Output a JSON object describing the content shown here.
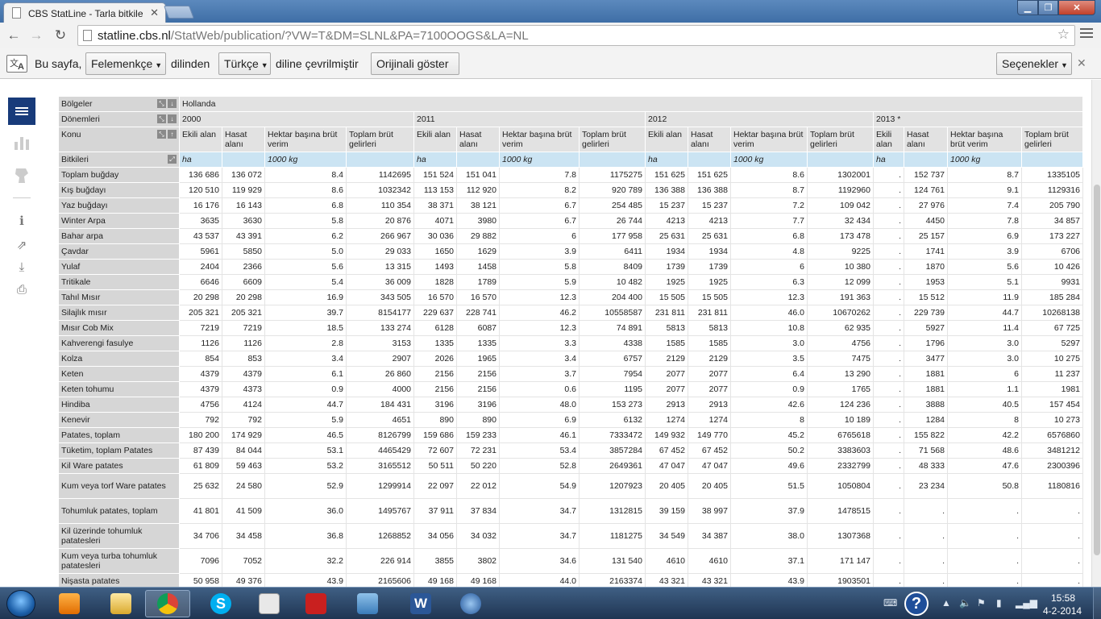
{
  "browser": {
    "tab_title": "CBS StatLine - Tarla bitkile",
    "url_domain": "statline.cbs.nl",
    "url_path": "/StatWeb/publication/?VW=T&DM=SLNL&PA=7100OOGS&LA=NL"
  },
  "translate_bar": {
    "prefix": "Bu sayfa,",
    "source_language": "Felemenkçe",
    "middle": "dilinden",
    "target_language": "Türkçe",
    "suffix": "diline çevrilmiştir",
    "show_original": "Orijinali göster",
    "options": "Seçenekler"
  },
  "table": {
    "header": {
      "regions_label": "Bölgeler",
      "region_value": "Hollanda",
      "periods_label": "Dönemleri",
      "subject_label": "Konu",
      "crops_label": "Bitkileri",
      "years": [
        "2000",
        "2011",
        "2012",
        "2013 *"
      ],
      "columns": [
        "Ekili alan",
        "Hasat alanı",
        "Hektar başına brüt verim",
        "Toplam brüt gelirleri"
      ],
      "units": [
        "ha",
        "1000 kg"
      ]
    },
    "rows": [
      {
        "label": "Toplam buğday",
        "v": [
          "136 686",
          "136 072",
          "8.4",
          "1142695",
          "151 524",
          "151 041",
          "7.8",
          "1175275",
          "151 625",
          "151 625",
          "8.6",
          "1302001",
          ".",
          "152 737",
          "8.7",
          "1335105"
        ]
      },
      {
        "label": "Kış buğdayı",
        "v": [
          "120 510",
          "119 929",
          "8.6",
          "1032342",
          "113 153",
          "112 920",
          "8.2",
          "920 789",
          "136 388",
          "136 388",
          "8.7",
          "1192960",
          ".",
          "124 761",
          "9.1",
          "1129316"
        ]
      },
      {
        "label": "Yaz buğdayı",
        "v": [
          "16 176",
          "16 143",
          "6.8",
          "110 354",
          "38 371",
          "38 121",
          "6.7",
          "254 485",
          "15 237",
          "15 237",
          "7.2",
          "109 042",
          ".",
          "27 976",
          "7.4",
          "205 790"
        ]
      },
      {
        "label": "Winter Arpa",
        "v": [
          "3635",
          "3630",
          "5.8",
          "20 876",
          "4071",
          "3980",
          "6.7",
          "26 744",
          "4213",
          "4213",
          "7.7",
          "32 434",
          ".",
          "4450",
          "7.8",
          "34 857"
        ]
      },
      {
        "label": "Bahar arpa",
        "v": [
          "43 537",
          "43 391",
          "6.2",
          "266 967",
          "30 036",
          "29 882",
          "6",
          "177 958",
          "25 631",
          "25 631",
          "6.8",
          "173 478",
          ".",
          "25 157",
          "6.9",
          "173 227"
        ]
      },
      {
        "label": "Çavdar",
        "v": [
          "5961",
          "5850",
          "5.0",
          "29 033",
          "1650",
          "1629",
          "3.9",
          "6411",
          "1934",
          "1934",
          "4.8",
          "9225",
          ".",
          "1741",
          "3.9",
          "6706"
        ]
      },
      {
        "label": "Yulaf",
        "v": [
          "2404",
          "2366",
          "5.6",
          "13 315",
          "1493",
          "1458",
          "5.8",
          "8409",
          "1739",
          "1739",
          "6",
          "10 380",
          ".",
          "1870",
          "5.6",
          "10 426"
        ]
      },
      {
        "label": "Tritikale",
        "v": [
          "6646",
          "6609",
          "5.4",
          "36 009",
          "1828",
          "1789",
          "5.9",
          "10 482",
          "1925",
          "1925",
          "6.3",
          "12 099",
          ".",
          "1953",
          "5.1",
          "9931"
        ]
      },
      {
        "label": "Tahıl Mısır",
        "v": [
          "20 298",
          "20 298",
          "16.9",
          "343 505",
          "16 570",
          "16 570",
          "12.3",
          "204 400",
          "15 505",
          "15 505",
          "12.3",
          "191 363",
          ".",
          "15 512",
          "11.9",
          "185 284"
        ]
      },
      {
        "label": "Silajlık mısır",
        "v": [
          "205 321",
          "205 321",
          "39.7",
          "8154177",
          "229 637",
          "228 741",
          "46.2",
          "10558587",
          "231 811",
          "231 811",
          "46.0",
          "10670262",
          ".",
          "229 739",
          "44.7",
          "10268138"
        ]
      },
      {
        "label": "Mısır Cob Mix",
        "v": [
          "7219",
          "7219",
          "18.5",
          "133 274",
          "6128",
          "6087",
          "12.3",
          "74 891",
          "5813",
          "5813",
          "10.8",
          "62 935",
          ".",
          "5927",
          "11.4",
          "67 725"
        ]
      },
      {
        "label": "Kahverengi fasulye",
        "v": [
          "1126",
          "1126",
          "2.8",
          "3153",
          "1335",
          "1335",
          "3.3",
          "4338",
          "1585",
          "1585",
          "3.0",
          "4756",
          ".",
          "1796",
          "3.0",
          "5297"
        ]
      },
      {
        "label": "Kolza",
        "v": [
          "854",
          "853",
          "3.4",
          "2907",
          "2026",
          "1965",
          "3.4",
          "6757",
          "2129",
          "2129",
          "3.5",
          "7475",
          ".",
          "3477",
          "3.0",
          "10 275"
        ]
      },
      {
        "label": "Keten",
        "v": [
          "4379",
          "4379",
          "6.1",
          "26 860",
          "2156",
          "2156",
          "3.7",
          "7954",
          "2077",
          "2077",
          "6.4",
          "13 290",
          ".",
          "1881",
          "6",
          "11 237"
        ]
      },
      {
        "label": "Keten tohumu",
        "v": [
          "4379",
          "4373",
          "0.9",
          "4000",
          "2156",
          "2156",
          "0.6",
          "1195",
          "2077",
          "2077",
          "0.9",
          "1765",
          ".",
          "1881",
          "1.1",
          "1981"
        ]
      },
      {
        "label": "Hindiba",
        "v": [
          "4756",
          "4124",
          "44.7",
          "184 431",
          "3196",
          "3196",
          "48.0",
          "153 273",
          "2913",
          "2913",
          "42.6",
          "124 236",
          ".",
          "3888",
          "40.5",
          "157 454"
        ]
      },
      {
        "label": "Kenevir",
        "v": [
          "792",
          "792",
          "5.9",
          "4651",
          "890",
          "890",
          "6.9",
          "6132",
          "1274",
          "1274",
          "8",
          "10 189",
          ".",
          "1284",
          "8",
          "10 273"
        ]
      },
      {
        "label": "Patates, toplam",
        "v": [
          "180 200",
          "174 929",
          "46.5",
          "8126799",
          "159 686",
          "159 233",
          "46.1",
          "7333472",
          "149 932",
          "149 770",
          "45.2",
          "6765618",
          ".",
          "155 822",
          "42.2",
          "6576860"
        ]
      },
      {
        "label": "Tüketim, toplam Patates",
        "v": [
          "87 439",
          "84 044",
          "53.1",
          "4465429",
          "72 607",
          "72 231",
          "53.4",
          "3857284",
          "67 452",
          "67 452",
          "50.2",
          "3383603",
          ".",
          "71 568",
          "48.6",
          "3481212"
        ]
      },
      {
        "label": "Kil Ware patates",
        "v": [
          "61 809",
          "59 463",
          "53.2",
          "3165512",
          "50 511",
          "50 220",
          "52.8",
          "2649361",
          "47 047",
          "47 047",
          "49.6",
          "2332799",
          ".",
          "48 333",
          "47.6",
          "2300396"
        ]
      },
      {
        "label": "Kum veya torf Ware patates",
        "tall": true,
        "v": [
          "25 632",
          "24 580",
          "52.9",
          "1299914",
          "22 097",
          "22 012",
          "54.9",
          "1207923",
          "20 405",
          "20 405",
          "51.5",
          "1050804",
          ".",
          "23 234",
          "50.8",
          "1180816"
        ]
      },
      {
        "label": "Tohumluk patates, toplam",
        "tall": true,
        "v": [
          "41 801",
          "41 509",
          "36.0",
          "1495767",
          "37 911",
          "37 834",
          "34.7",
          "1312815",
          "39 159",
          "38 997",
          "37.9",
          "1478515",
          ".",
          ".",
          ".",
          "."
        ]
      },
      {
        "label": "Kil üzerinde tohumluk patatesleri",
        "tall": true,
        "v": [
          "34 706",
          "34 458",
          "36.8",
          "1268852",
          "34 056",
          "34 032",
          "34.7",
          "1181275",
          "34 549",
          "34 387",
          "38.0",
          "1307368",
          ".",
          ".",
          ".",
          "."
        ]
      },
      {
        "label": "Kum veya turba tohumluk patatesleri",
        "tall": true,
        "v": [
          "7096",
          "7052",
          "32.2",
          "226 914",
          "3855",
          "3802",
          "34.6",
          "131 540",
          "4610",
          "4610",
          "37.1",
          "171 147",
          ".",
          ".",
          ".",
          "."
        ]
      },
      {
        "label": "Nişasta patates",
        "v": [
          "50 958",
          "49 376",
          "43.9",
          "2165606",
          "49 168",
          "49 168",
          "44.0",
          "2163374",
          "43 321",
          "43 321",
          "43.9",
          "1903501",
          ".",
          ".",
          ".",
          "."
        ]
      }
    ]
  },
  "taskbar": {
    "time": "15:58",
    "date": "4-2-2014",
    "help_glyph": "?"
  }
}
